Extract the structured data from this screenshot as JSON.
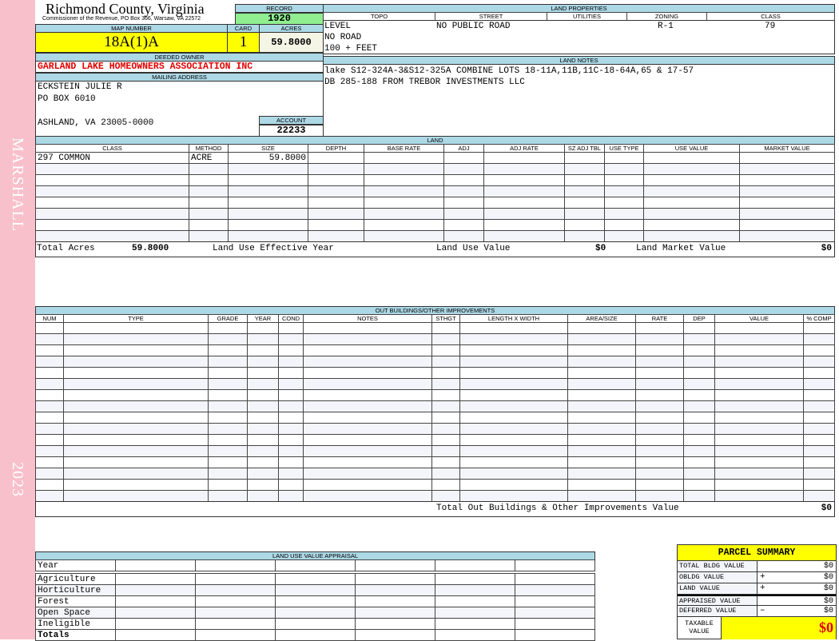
{
  "side": {
    "name": "MARSHALL",
    "year": "2023"
  },
  "header": {
    "county": "Richmond County, Virginia",
    "subtitle": "Commissioner of the Revenue, PO Box 366, Warsaw, VA 22572"
  },
  "record": {
    "label": "RECORD",
    "value": "1920"
  },
  "map": {
    "map_label": "MAP NUMBER",
    "map_number": "18A(1)A",
    "card_label": "CARD",
    "card": "1",
    "acres_label": "ACRES",
    "acres": "59.8000"
  },
  "owner": {
    "label": "DEEDED OWNER",
    "name": "GARLAND LAKE HOMEOWNERS ASSOCIATION INC",
    "mail_label": "MAILING ADDRESS",
    "line1": "ECKSTEIN JULIE R",
    "line2": "PO BOX 6010",
    "line3": "ASHLAND, VA 23005-0000",
    "account_label": "ACCOUNT",
    "account": "22233"
  },
  "land_props": {
    "title": "LAND PROPERTIES",
    "columns": [
      "TOPO",
      "STREET",
      "UTILITIES",
      "ZONING",
      "CLASS"
    ],
    "topo": [
      "LEVEL",
      "NO ROAD",
      "100 + FEET"
    ],
    "street": "NO PUBLIC ROAD",
    "zoning": "R-1",
    "class": "79"
  },
  "land_notes": {
    "title": "LAND NOTES",
    "lines": [
      "lake S12-324A-3&S12-325A COMBINE LOTS 18-11A,11B,11C-18-64A,65 & 17-57",
      "DB 285-188 FROM TREBOR INVESTMENTS LLC"
    ]
  },
  "land": {
    "title": "LAND",
    "columns": [
      "CLASS",
      "METHOD",
      "SIZE",
      "DEPTH",
      "BASE RATE",
      "ADJ",
      "ADJ RATE",
      "SZ ADJ TBL",
      "USE TYPE",
      "USE VALUE",
      "MARKET VALUE"
    ],
    "rows": [
      [
        "297    COMMON",
        "ACRE",
        "59.8000",
        "",
        "",
        "",
        "",
        "",
        "",
        "",
        ""
      ]
    ],
    "totals": {
      "acres_label": "Total Acres",
      "acres": "59.8000",
      "effective_label": "Land Use Effective Year",
      "use_label": "Land Use Value",
      "use_value": "$0",
      "market_label": "Land Market Value",
      "market_value": "$0"
    }
  },
  "outbuildings": {
    "title": "OUT BUILDINGS/OTHER IMPROVEMENTS",
    "columns": [
      "NUM",
      "TYPE",
      "GRADE",
      "YEAR",
      "COND",
      "NOTES",
      "STHGT",
      "LENGTH X WIDTH",
      "AREA/SIZE",
      "RATE",
      "DEP",
      "VALUE",
      "% COMP"
    ],
    "total_label": "Total Out Buildings & Other Improvements Value",
    "total_value": "$0"
  },
  "land_use": {
    "title": "LAND USE VALUE APPRAISAL",
    "year_label": "Year",
    "rows": [
      "Agriculture",
      "Horticulture",
      "Forest",
      "Open Space",
      "Ineligible"
    ],
    "totals_label": "Totals"
  },
  "summary": {
    "title": "PARCEL SUMMARY",
    "rows": [
      {
        "label": "TOTAL BLDG VALUE",
        "sign": "",
        "value": "$0"
      },
      {
        "label": "OBLDG VALUE",
        "sign": "+",
        "value": "$0"
      },
      {
        "label": "LAND VALUE",
        "sign": "+",
        "value": "$0"
      },
      {
        "label": "APPRAISED VALUE",
        "sign": "",
        "value": "$0"
      },
      {
        "label": "DEFERRED VALUE",
        "sign": "–",
        "value": "$0"
      }
    ],
    "taxable_label": "TAXABLE VALUE",
    "taxable_value": "$0"
  },
  "colors": {
    "header_blue": "#add8e6",
    "record_green": "#90ee90",
    "highlight_yellow": "#ffff00",
    "side_pink": "#f8c0cb",
    "owner_red": "#e00000"
  }
}
